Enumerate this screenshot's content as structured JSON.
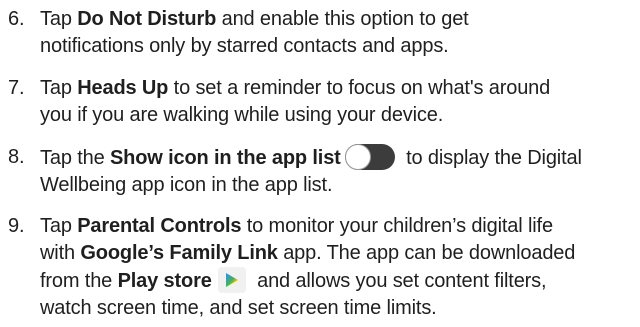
{
  "steps": [
    {
      "num": "6.",
      "pre": "Tap ",
      "bold": "Do Not Disturb",
      "post_line1": " and enable this option to get",
      "line2": "notifications only by starred contacts and apps."
    },
    {
      "num": "7.",
      "pre": "Tap ",
      "bold": "Heads Up",
      "post_line1": " to set a reminder to focus on what's around",
      "line2": "you if you are walking while using your device."
    },
    {
      "num": "8.",
      "pre": "Tap the ",
      "bold": "Show icon in the app list",
      "post_line1": " to display the Digital",
      "line2": "Wellbeing app icon in the app list.",
      "icon": "toggle-switch-icon"
    },
    {
      "num": "9.",
      "pre": "Tap ",
      "bold": "Parental Controls",
      "post_line1": " to monitor your children’s digital life",
      "line2_pre": "with ",
      "line2_bold": "Google’s Family Link",
      "line2_post": " app. The app can be downloaded",
      "line3_pre": "from the ",
      "line3_bold": "Play store",
      "line3_post": " and allows you set content filters,",
      "line4": "watch screen time, and set screen time limits.",
      "icon": "play-store-icon"
    }
  ]
}
